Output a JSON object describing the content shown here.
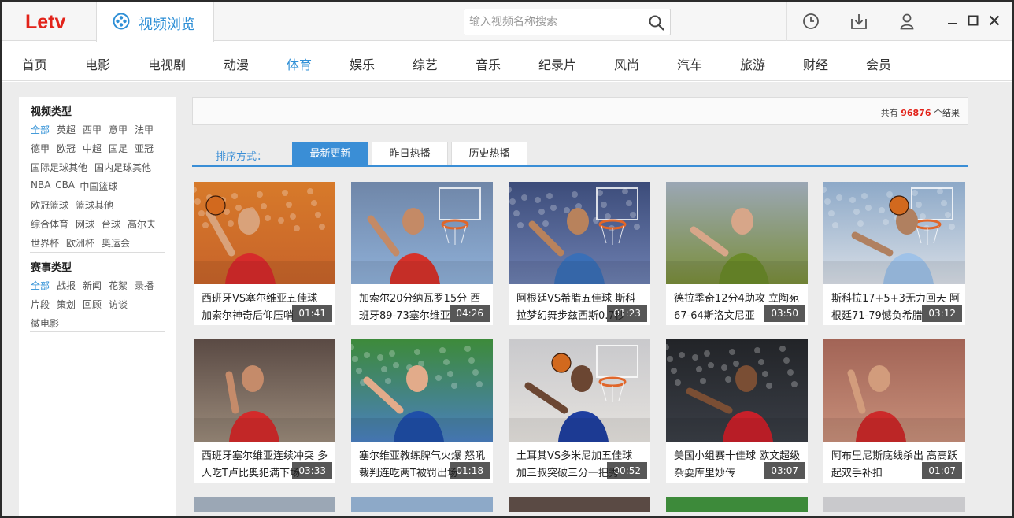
{
  "app": {
    "logo": "Letv",
    "tab_label": "视频浏览"
  },
  "search": {
    "placeholder": "输入视频名称搜索"
  },
  "nav": [
    "首页",
    "电影",
    "电视剧",
    "动漫",
    "体育",
    "娱乐",
    "综艺",
    "音乐",
    "纪录片",
    "风尚",
    "汽车",
    "旅游",
    "财经",
    "会员"
  ],
  "nav_active": "体育",
  "sidebar": {
    "video_type_title": "视频类型",
    "video_type_tags": [
      [
        "全部",
        "英超",
        "西甲",
        "意甲",
        "法甲"
      ],
      [
        "德甲",
        "欧冠",
        "中超",
        "国足",
        "亚冠"
      ],
      [
        "国际足球其他",
        "国内足球其他"
      ],
      [
        "NBA",
        "CBA",
        "中国篮球"
      ],
      [
        "欧冠篮球",
        "篮球其他"
      ],
      [
        "综合体育",
        "网球",
        "台球",
        "高尔夫"
      ],
      [
        "世界杯",
        "欧洲杯",
        "奥运会"
      ]
    ],
    "event_type_title": "赛事类型",
    "event_type_tags": [
      [
        "全部",
        "战报",
        "新闻",
        "花絮",
        "录播"
      ],
      [
        "片段",
        "策划",
        "回顾",
        "访谈"
      ],
      [
        "微电影"
      ]
    ]
  },
  "results": {
    "prefix": "共有",
    "count": "96876",
    "suffix": "个结果"
  },
  "sort": {
    "label": "排序方式：",
    "tabs": [
      "最新更新",
      "昨日热播",
      "历史热播"
    ],
    "active": "最新更新"
  },
  "videos": [
    {
      "duration": "01:41",
      "title": "西班牙VS塞尔维亚五佳球 加索尔神奇后仰压哨"
    },
    {
      "duration": "04:26",
      "title": "加索尔20分纳瓦罗15分 西班牙89-73塞尔维亚"
    },
    {
      "duration": "01:23",
      "title": "阿根廷VS希腊五佳球 斯科拉梦幻舞步兹西斯0.7秒"
    },
    {
      "duration": "03:50",
      "title": "德拉季奇12分4助攻 立陶宛67-64斯洛文尼亚"
    },
    {
      "duration": "03:12",
      "title": "斯科拉17+5+3无力回天 阿根廷71-79憾负希腊"
    },
    {
      "duration": "03:33",
      "title": "西班牙塞尔维亚连续冲突 多人吃T卢比奥犯满下场"
    },
    {
      "duration": "01:18",
      "title": "塞尔维亚教练脾气火爆 怒吼裁判连吃两T被罚出场"
    },
    {
      "duration": "00:52",
      "title": "土耳其VS多米尼加五佳球 加三叔突破三分一把秀"
    },
    {
      "duration": "03:07",
      "title": "美国小组赛十佳球 欧文超级杂耍库里妙传"
    },
    {
      "duration": "01:07",
      "title": "阿布里尼斯底线杀出 高高跃起双手补扣"
    }
  ],
  "colors": {
    "brand_red": "#e2231a",
    "accent_blue": "#2e8fd6"
  }
}
